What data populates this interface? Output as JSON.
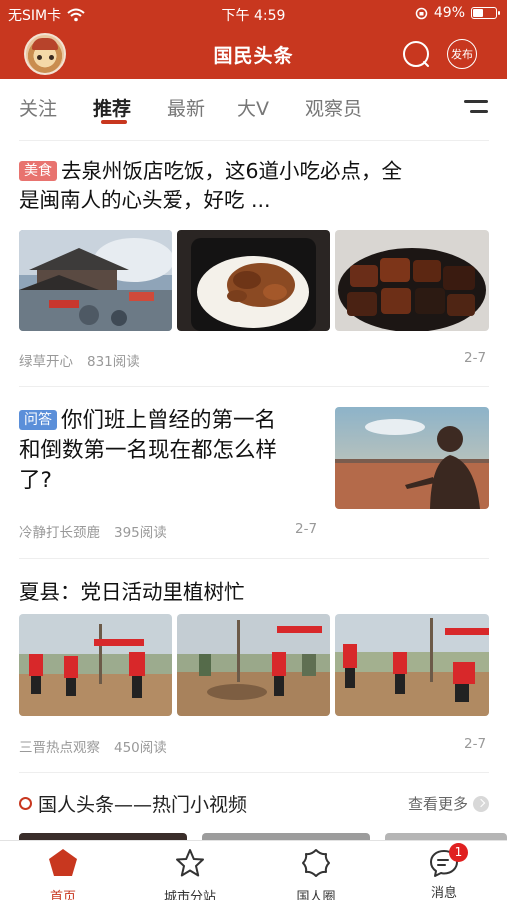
{
  "status_bar": {
    "carrier": "无SIM卡",
    "time": "下午 4:59",
    "battery": "49%",
    "battery_level": 0.49
  },
  "header": {
    "title": "国民头条",
    "publish_label": "发布"
  },
  "tabs": [
    {
      "label": "关注"
    },
    {
      "label": "推荐",
      "active": true
    },
    {
      "label": "最新"
    },
    {
      "label": "大V"
    },
    {
      "label": "观察员"
    }
  ],
  "articles": [
    {
      "tag": "美食",
      "tag_color": "#e8736f",
      "title_line1": "去泉州饭店吃饭，这6道小吃必点，全",
      "title_line2": "是闽南人的心头爱，好吃 ...",
      "source": "绿草开心",
      "reads": "831阅读",
      "date": "2-7"
    },
    {
      "tag": "问答",
      "tag_color": "#5b8fd9",
      "title_line1": "你们班上曾经的第一名",
      "title_line2": "和倒数第一名现在都怎么样",
      "title_line3": "了?",
      "source": "冷静打长颈鹿",
      "reads": "395阅读",
      "date": "2-7"
    },
    {
      "title_line1": "夏县：党日活动里植树忙",
      "source": "三晋热点观察",
      "reads": "450阅读",
      "date": "2-7"
    }
  ],
  "video_section": {
    "title": "国人头条——热门小视频",
    "more_label": "查看更多"
  },
  "tabbar": [
    {
      "label": "首页",
      "icon": "pentagon-home-icon",
      "active": true
    },
    {
      "label": "城市分站",
      "icon": "star-outline-icon"
    },
    {
      "label": "国人圈",
      "icon": "flower-outline-icon"
    },
    {
      "label": "消息",
      "icon": "chat-bubble-icon",
      "badge": "1"
    }
  ],
  "colors": {
    "brand_red": "#c8371f",
    "muted_text": "#999999",
    "badge_red": "#e02020"
  }
}
